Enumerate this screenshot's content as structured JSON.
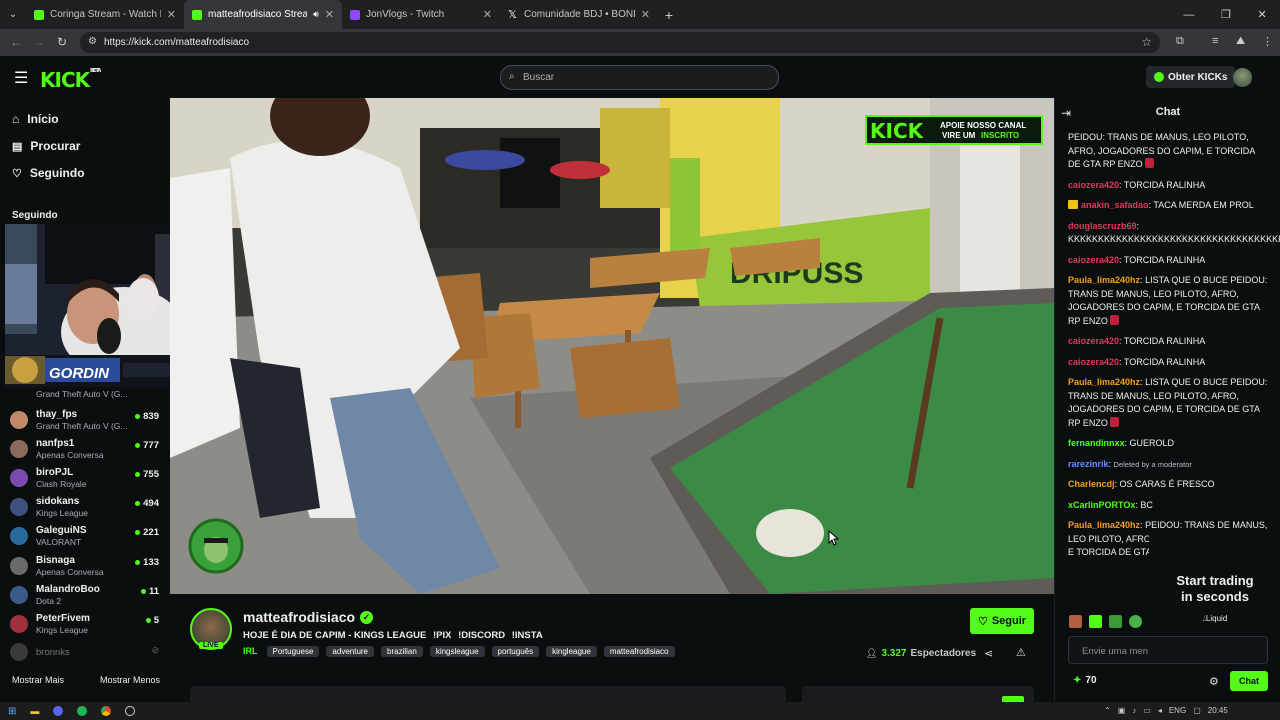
{
  "browser": {
    "tabs": [
      {
        "title": "Coringa Stream - Watch Live on",
        "color": "#53fc18"
      },
      {
        "title": "matteafrodisiaco Stream - W",
        "color": "#53fc18"
      },
      {
        "title": "JonVlogs - Twitch",
        "color": "#9146ff"
      },
      {
        "title": "Comunidade BDJ • BONDE DO",
        "color": "#ffffff"
      }
    ],
    "url": "https://kick.com/matteafrodisiaco"
  },
  "header": {
    "logo": "KICK",
    "logo_tag": "BETA",
    "search_placeholder": "Buscar",
    "obter_label": "Obter KICKs"
  },
  "sidebar": {
    "nav": [
      {
        "label": "Início",
        "icon": "home-icon"
      },
      {
        "label": "Procurar",
        "icon": "browse-icon"
      },
      {
        "label": "Seguindo",
        "icon": "heart-icon"
      }
    ],
    "section_title": "Seguindo",
    "overlay_name": "GORDIN",
    "partial_game": "Grand Theft Auto V (G...",
    "following": [
      {
        "name": "thay_fps",
        "game": "Grand Theft Auto V (G...",
        "viewers": "839",
        "color": "#c08a6a"
      },
      {
        "name": "nanfps1",
        "game": "Apenas Conversa",
        "viewers": "777",
        "color": "#8a6a5a"
      },
      {
        "name": "biroPJL",
        "game": "Clash Royale",
        "viewers": "755",
        "color": "#7a4ab0"
      },
      {
        "name": "sidokans",
        "game": "Kings League",
        "viewers": "494",
        "color": "#405080"
      },
      {
        "name": "GaleguiNS",
        "game": "VALORANT",
        "viewers": "221",
        "color": "#2a6a9a"
      },
      {
        "name": "Bisnaga",
        "game": "Apenas Conversa",
        "viewers": "133",
        "color": "#6a6a6a"
      },
      {
        "name": "MalandroBoo",
        "game": "Dota 2",
        "viewers": "11",
        "color": "#3a5a8a"
      },
      {
        "name": "PeterFivem",
        "game": "Kings League",
        "viewers": "5",
        "color": "#a03040"
      }
    ],
    "offline_name": "bronnks",
    "show_more": "Mostrar Mais",
    "show_less": "Mostrar Menos"
  },
  "video": {
    "banner_logo": "KICK",
    "banner_line1": "APOIE NOSSO CANAL",
    "banner_line2": "VIRE UM",
    "banner_line2b": "INSCRITO",
    "wall_text": "DRIPUSS"
  },
  "channel": {
    "name": "matteafrodisiaco",
    "title": "HOJE É DIA DE CAPIM - KINGS LEAGUE",
    "commands": [
      "!PIX",
      "!DISCORD",
      "!INSTA"
    ],
    "category": "IRL",
    "tags": [
      "Portuguese",
      "adventure",
      "brazilian",
      "kingsleague",
      "português",
      "kingleague",
      "matteafrodisiaco"
    ],
    "live_label": "LIVE",
    "follow_label": "Seguir",
    "viewer_count": "3.327",
    "viewer_label": "Espectadores"
  },
  "chat": {
    "title": "Chat",
    "messages": [
      {
        "user": "",
        "user_color": "#ff4d6a",
        "text": "PEIDOU: TRANS DE MANUS, LEO PILOTO, AFRO, JOGADORES DO CAPIM, E TORCIDA DE GTA RP ENZO",
        "emote": true
      },
      {
        "user": "caiozera420",
        "user_color": "#e03a5a",
        "text": "TORCIDA RALINHA"
      },
      {
        "user": "anakin_safadao",
        "user_color": "#e03a5a",
        "text": "TACA MERDA EM PROL",
        "crown": true
      },
      {
        "user": "douglascruzb69",
        "user_color": "#e03a5a",
        "text": "KKKKKKKKKKKKKKKKKKKKKKKKKKKKKKKKKKKKKKKKKKKKKKKKKKKKKKKKKKKKKKKKKKKKKKKKKKKKKKKKK"
      },
      {
        "user": "caiozera420",
        "user_color": "#e03a5a",
        "text": "TORCIDA RALINHA"
      },
      {
        "user": "Paula_lima240hz",
        "user_color": "#f0a020",
        "text": "LISTA QUE O BUCE PEIDOU: TRANS DE MANUS, LEO PILOTO, AFRO, JOGADORES DO CAPIM, E TORCIDA DE GTA RP ENZO",
        "emote": true
      },
      {
        "user": "caiozera420",
        "user_color": "#e03a5a",
        "text": "TORCIDA RALINHA"
      },
      {
        "user": "caiozera420",
        "user_color": "#e03a5a",
        "text": "TORCIDA RALINHA"
      },
      {
        "user": "Paula_lima240hz",
        "user_color": "#f0a020",
        "text": "LISTA QUE O BUCE PEIDOU: TRANS DE MANUS, LEO PILOTO, AFRO, JOGADORES DO CAPIM, E TORCIDA DE GTA RP ENZO",
        "emote": true
      },
      {
        "user": "fernandinnxx",
        "user_color": "#53fc18",
        "text": "GUEROLD"
      },
      {
        "user": "rarezinrik",
        "user_color": "#6a8aff",
        "text": "Deleted by a moderator",
        "deleted": true
      },
      {
        "user": "Charlencdj",
        "user_color": "#f0a020",
        "text": "OS CARAS É FRESCO"
      },
      {
        "user": "xCarlinPORTOx",
        "user_color": "#53fc18",
        "text": "BC"
      },
      {
        "user": "Paula_lima240hz",
        "user_color": "#f0a020",
        "text": "PEIDOU: TRANS DE MANUS, LEO PILOTO, AFRO, JOGADORES DO CAPIM, E TORCIDA DE GTA RP ENZO",
        "emote": true
      }
    ],
    "ad_line1": "Start trading",
    "ad_line2": "in seconds",
    "ad_brand": "Liquid",
    "input_placeholder": "Envie uma men",
    "points": "70",
    "send_label": "Chat"
  },
  "taskbar": {
    "lang": "ENG",
    "time": "20:45"
  }
}
